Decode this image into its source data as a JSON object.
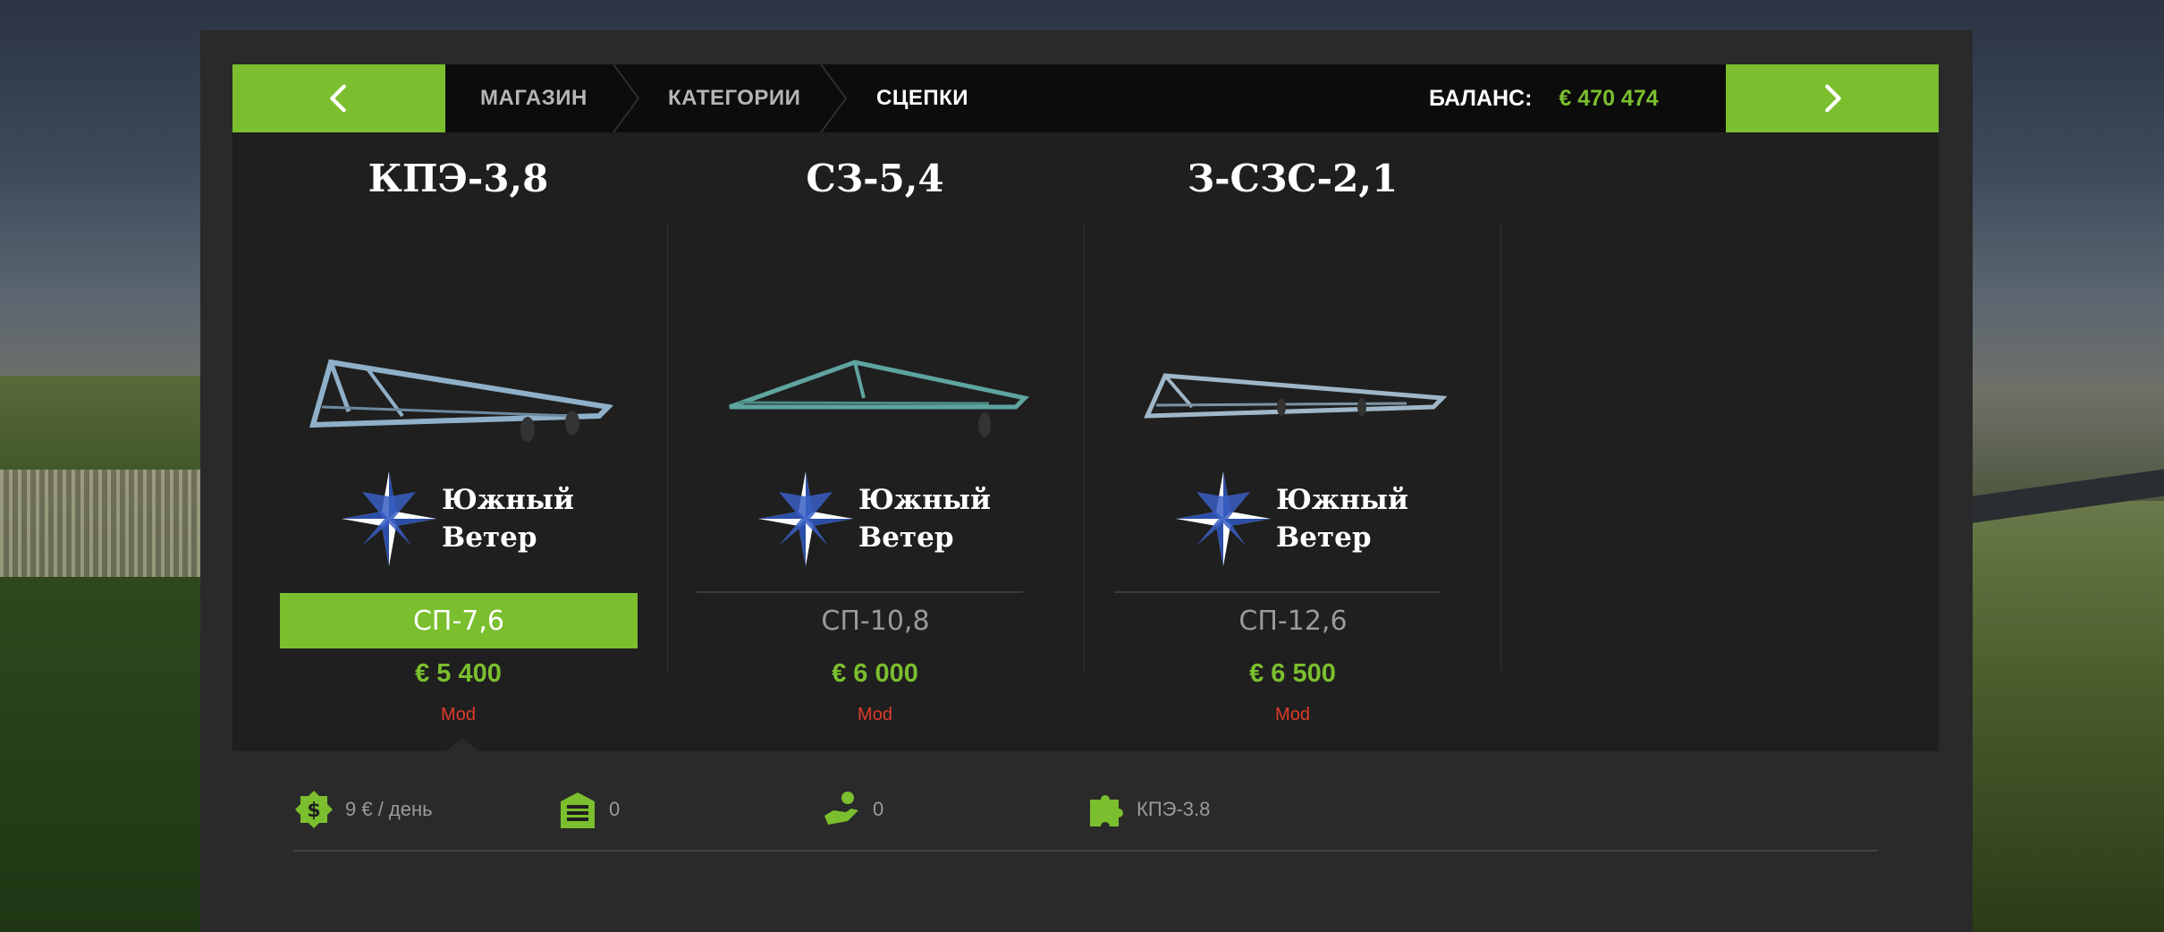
{
  "nav": {
    "prev_icon": "chevron-left-icon",
    "next_icon": "chevron-right-icon"
  },
  "breadcrumb": {
    "shop": "МАГАЗИН",
    "categories": "КАТЕГОРИИ",
    "current": "СЦЕПКИ"
  },
  "balance": {
    "label": "БАЛАНС:",
    "value": "€ 470 474"
  },
  "items": [
    {
      "title": "КПЭ-3,8",
      "brand_line1": "Южный",
      "brand_line2": "Ветер",
      "model": "СП-7,6",
      "price": "€ 5 400",
      "tag": "Mod",
      "selected": true
    },
    {
      "title": "СЗ-5,4",
      "brand_line1": "Южный",
      "brand_line2": "Ветер",
      "model": "СП-10,8",
      "price": "€ 6 000",
      "tag": "Mod",
      "selected": false
    },
    {
      "title": "З-СЗС-2,1",
      "brand_line1": "Южный",
      "brand_line2": "Ветер",
      "model": "СП-12,6",
      "price": "€ 6 500",
      "tag": "Mod",
      "selected": false
    }
  ],
  "details": {
    "upkeep": {
      "icon": "money-icon",
      "value": "9 € / день"
    },
    "storage": {
      "icon": "garage-icon",
      "value": "0"
    },
    "capacity": {
      "icon": "hand-icon",
      "value": "0"
    },
    "mod": {
      "icon": "puzzle-icon",
      "value": "КПЭ-3.8"
    }
  },
  "colors": {
    "accent": "#7bbf2e",
    "mod_tag": "#e03a2a",
    "panel": "#2a2a2a",
    "topbar": "#0c0c0c"
  }
}
